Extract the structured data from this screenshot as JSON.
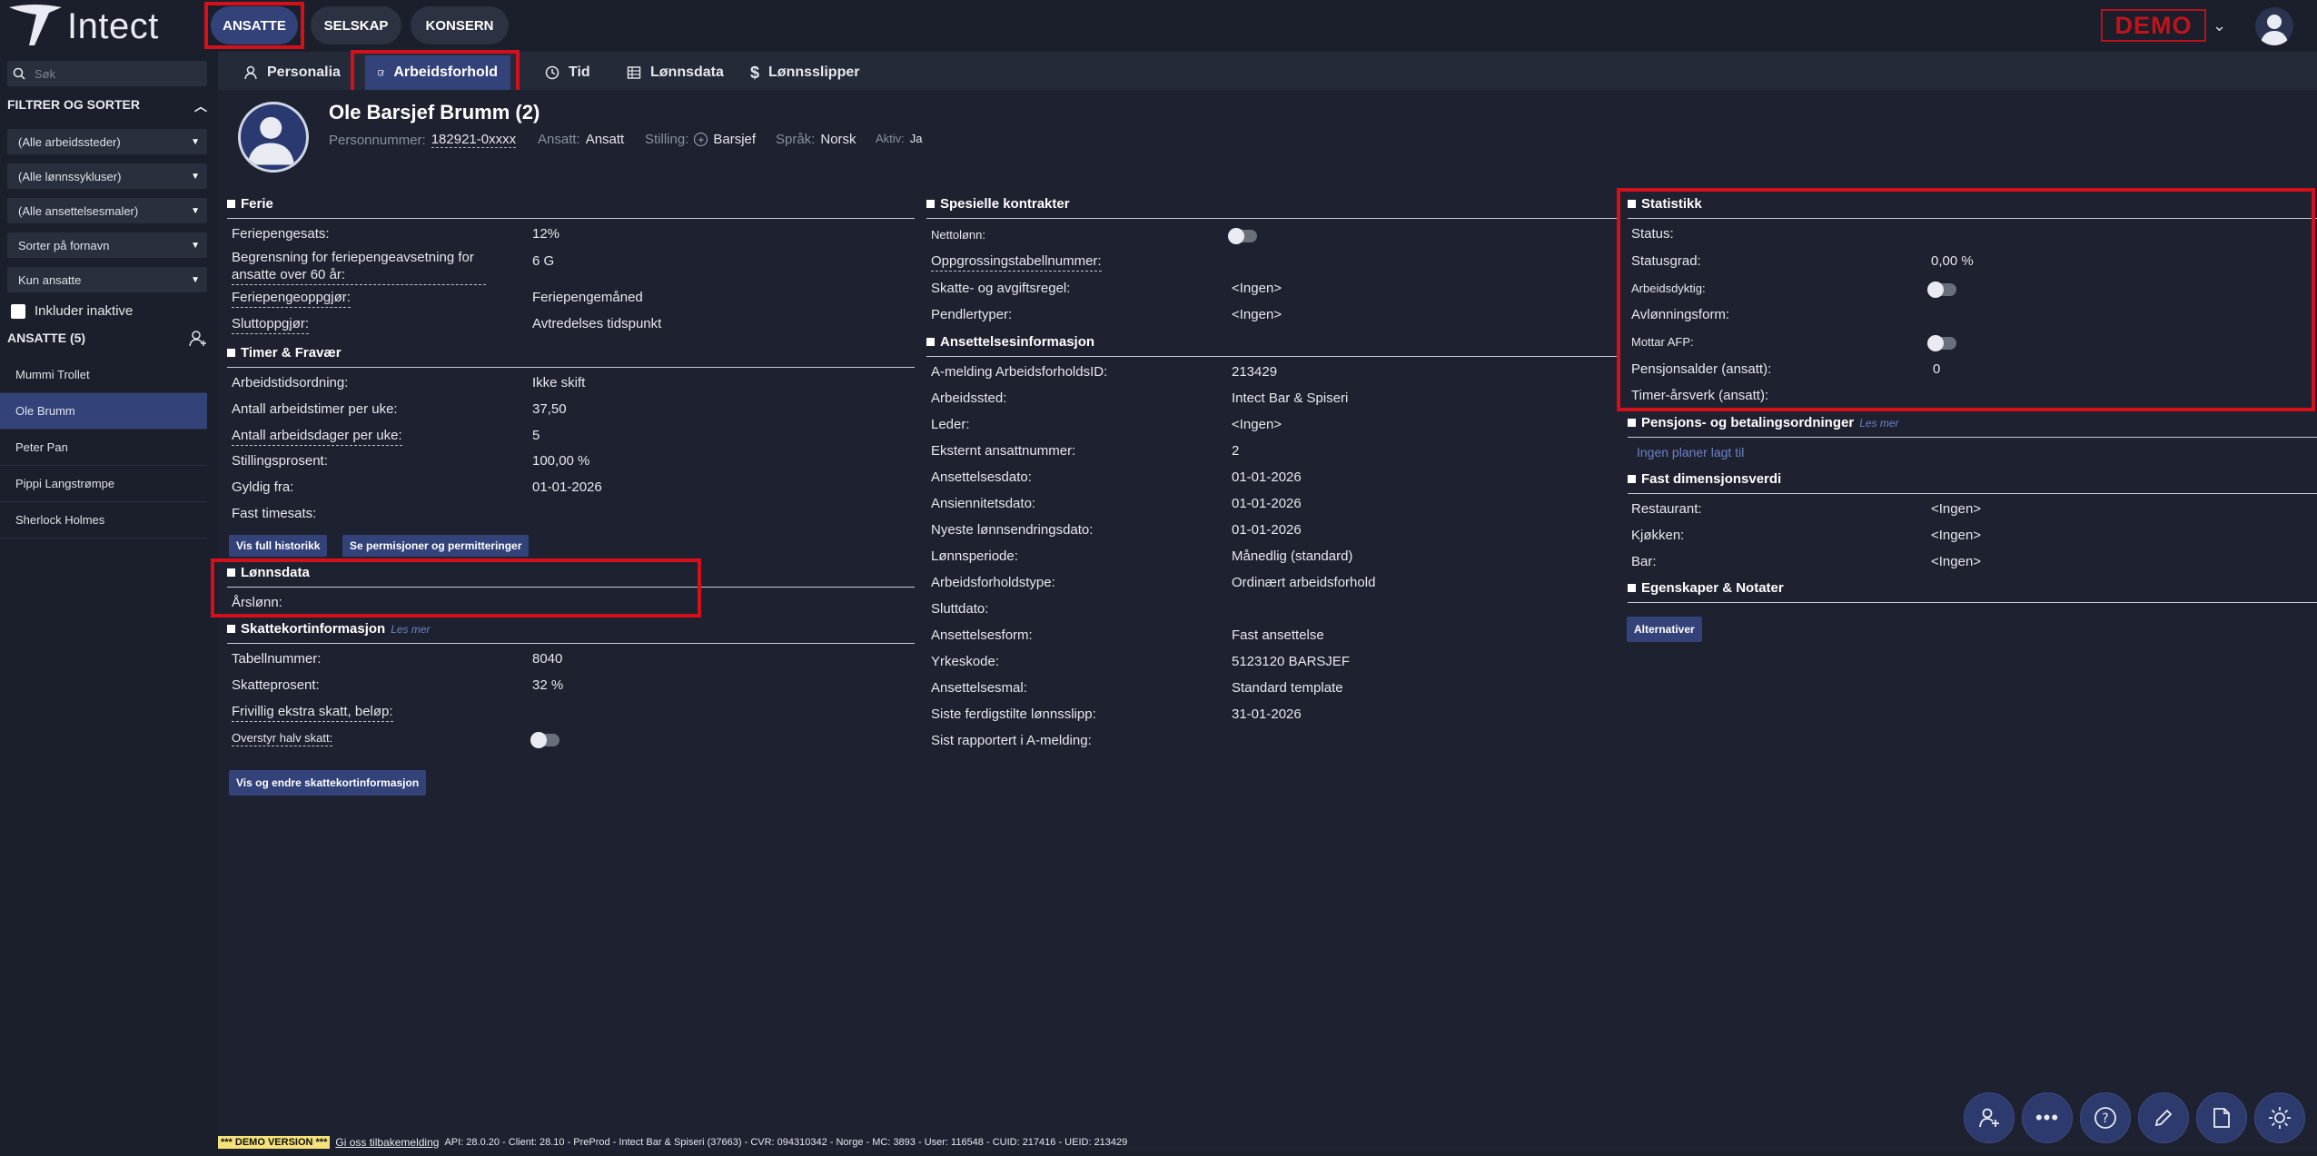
{
  "app": {
    "name": "Intect",
    "demo_badge": "DEMO"
  },
  "topnav": {
    "employees": "ANSATTE",
    "company": "SELSKAP",
    "group": "KONSERN"
  },
  "sidebar": {
    "search_placeholder": "Søk",
    "filter_title": "FILTRER OG SORTER",
    "dropdowns": [
      "(Alle arbeidssteder)",
      "(Alle lønnssykluser)",
      "(Alle ansettelsesmaler)",
      "Sorter på fornavn",
      "Kun ansatte"
    ],
    "include_inactive": "Inkluder inaktive",
    "employees_title": "ANSATTE (5)",
    "employees": [
      "Mummi Trollet",
      "Ole Brumm",
      "Peter Pan",
      "Pippi Langstrømpe",
      "Sherlock Holmes"
    ]
  },
  "tabs": [
    "Personalia",
    "Arbeidsforhold",
    "Tid",
    "Lønnsdata",
    "Lønnsslipper"
  ],
  "profile": {
    "name": "Ole Barsjef Brumm (2)",
    "pnr_label": "Personnummer:",
    "pnr": "182921-0xxxx",
    "employed_label": "Ansatt:",
    "employed": "Ansatt",
    "position_label": "Stilling:",
    "position": "Barsjef",
    "language_label": "Språk:",
    "language": "Norsk",
    "active_label": "Aktiv:",
    "active": "Ja"
  },
  "ferie": {
    "title": "Ferie",
    "rows": [
      {
        "label": "Feriepengesats:",
        "value": "12%"
      },
      {
        "label": "Begrensning for feriepengeavsetning for ansatte over 60 år:",
        "value": "6 G"
      },
      {
        "label": "Feriepengeoppgjør:",
        "value": "Feriepengemåned"
      },
      {
        "label": "Sluttoppgjør:",
        "value": "Avtredelses tidspunkt"
      }
    ]
  },
  "timer": {
    "title": "Timer & Fravær",
    "rows": [
      {
        "label": "Arbeidstidsordning:",
        "value": "Ikke skift"
      },
      {
        "label": "Antall arbeidstimer per uke:",
        "value": "37,50"
      },
      {
        "label": "Antall arbeidsdager per uke:",
        "value": "5"
      },
      {
        "label": "Stillingsprosent:",
        "value": "100,00 %"
      },
      {
        "label": "Gyldig fra:",
        "value": "01-01-2026"
      },
      {
        "label": "Fast timesats:",
        "value": ""
      }
    ],
    "btn_history": "Vis full historikk",
    "btn_leave": "Se permisjoner og permitteringer"
  },
  "lonnsdata": {
    "title": "Lønnsdata",
    "annual_label": "Årslønn:"
  },
  "skatt": {
    "title": "Skattekortinformasjon",
    "more": "Les mer",
    "rows": [
      {
        "label": "Tabellnummer:",
        "value": "8040"
      },
      {
        "label": "Skatteprosent:",
        "value": "32 %"
      },
      {
        "label": "Frivillig ekstra skatt, beløp:",
        "value": ""
      },
      {
        "label": "Overstyr halv skatt:",
        "value": ""
      }
    ],
    "btn": "Vis og endre skattekortinformasjon"
  },
  "spesielle": {
    "title": "Spesielle kontrakter",
    "rows": [
      {
        "label": "Nettolønn:",
        "value": ""
      },
      {
        "label": "Oppgrossingstabellnummer:",
        "value": ""
      },
      {
        "label": "Skatte- og avgiftsregel:",
        "value": "<Ingen>"
      },
      {
        "label": "Pendlertyper:",
        "value": "<Ingen>"
      }
    ]
  },
  "ansettelse": {
    "title": "Ansettelsesinformasjon",
    "rows": [
      {
        "label": "A-melding ArbeidsforholdsID:",
        "value": "213429"
      },
      {
        "label": "Arbeidssted:",
        "value": "Intect Bar & Spiseri"
      },
      {
        "label": "Leder:",
        "value": "<Ingen>"
      },
      {
        "label": "Eksternt ansattnummer:",
        "value": "2"
      },
      {
        "label": "Ansettelsesdato:",
        "value": "01-01-2026"
      },
      {
        "label": "Ansiennitetsdato:",
        "value": "01-01-2026"
      },
      {
        "label": "Nyeste lønnsendringsdato:",
        "value": "01-01-2026"
      },
      {
        "label": "Lønnsperiode:",
        "value": "Månedlig (standard)"
      },
      {
        "label": "Arbeidsforholdstype:",
        "value": "Ordinært arbeidsforhold"
      },
      {
        "label": "Sluttdato:",
        "value": ""
      },
      {
        "label": "Ansettelsesform:",
        "value": "Fast ansettelse"
      },
      {
        "label": "Yrkeskode:",
        "value": "5123120 BARSJEF"
      },
      {
        "label": "Ansettelsesmal:",
        "value": "Standard template"
      },
      {
        "label": "Siste ferdigstilte lønnsslipp:",
        "value": "31-01-2026"
      },
      {
        "label": "Sist rapportert i A-melding:",
        "value": ""
      }
    ]
  },
  "statistikk": {
    "title": "Statistikk",
    "rows": [
      {
        "label": "Status:",
        "value": ""
      },
      {
        "label": "Statusgrad:",
        "value": "0,00 %"
      },
      {
        "label": "Arbeidsdyktig:",
        "value": ""
      },
      {
        "label": "Avlønningsform:",
        "value": ""
      },
      {
        "label": "Mottar AFP:",
        "value": ""
      },
      {
        "label": "Pensjonsalder (ansatt):",
        "value": "0"
      },
      {
        "label": "Timer-årsverk (ansatt):",
        "value": ""
      }
    ]
  },
  "pensjon": {
    "title": "Pensjons- og betalingsordninger",
    "more": "Les mer",
    "empty": "Ingen planer lagt til"
  },
  "dimensjon": {
    "title": "Fast dimensjonsverdi",
    "rows": [
      {
        "label": "Restaurant:",
        "value": "<Ingen>"
      },
      {
        "label": "Kjøkken:",
        "value": "<Ingen>"
      },
      {
        "label": "Bar:",
        "value": "<Ingen>"
      }
    ]
  },
  "egenskaper": {
    "title": "Egenskaper & Notater",
    "btn": "Alternativer"
  },
  "footer": {
    "demo_version": "*** DEMO VERSION ***",
    "feedback": "Gi oss tilbakemelding",
    "info": "API: 28.0.20 - Client: 28.10 - PreProd  - Intect Bar & Spiseri (37663) - CVR: 094310342 - Norge - MC: 3893   - User: 116548  - CUID: 217416  - UEID: 213429"
  }
}
